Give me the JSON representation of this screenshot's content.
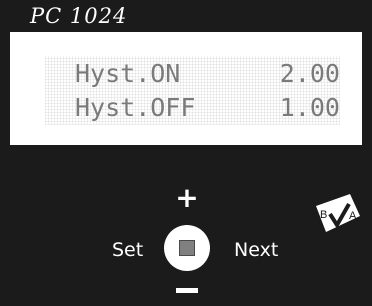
{
  "device": {
    "model": "PC 1024"
  },
  "display": {
    "rows": [
      {
        "label": "Hyst.ON",
        "value": "2.00"
      },
      {
        "label": "Hyst.OFF",
        "value": "1.00"
      }
    ]
  },
  "controls": {
    "plus_label": "+",
    "set_label": "Set",
    "next_label": "Next",
    "minus_icon": "minus-icon",
    "center_icon": "square-stop-icon"
  },
  "logo": {
    "letters": "BVA"
  },
  "colors": {
    "background": "#1b1b1b",
    "panel": "#ffffff",
    "lcd_text": "#7a7a7a",
    "button_square": "#808080"
  }
}
